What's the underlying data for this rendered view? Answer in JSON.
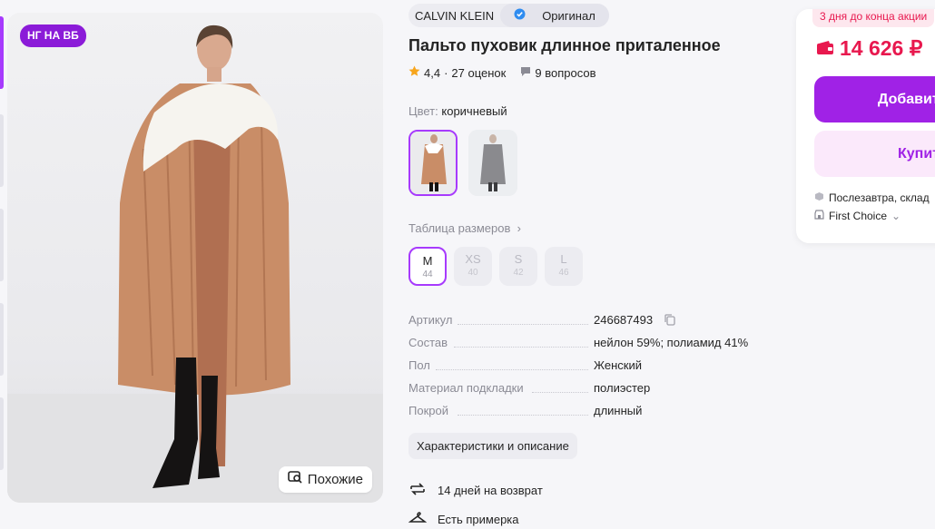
{
  "badge": "НГ НА ВБ",
  "similar_button": "Похожие",
  "brand": "CALVIN KLEIN",
  "original_label": "Оригинал",
  "title": "Пальто пуховик длинное приталенное",
  "rating": {
    "value": "4,4",
    "separator": "·",
    "reviews": "27 оценок",
    "questions": "9 вопросов"
  },
  "color": {
    "label": "Цвет:",
    "value": "коричневый"
  },
  "size_table_link": "Таблица размеров",
  "sizes": [
    {
      "name": "M",
      "ru": "44"
    },
    {
      "name": "XS",
      "ru": "40"
    },
    {
      "name": "S",
      "ru": "42"
    },
    {
      "name": "L",
      "ru": "46"
    }
  ],
  "specs": [
    {
      "key": "Артикул",
      "value": "246687493"
    },
    {
      "key": "Состав",
      "value": "нейлон 59%; полиамид 41%"
    },
    {
      "key": "Пол",
      "value": "Женский"
    },
    {
      "key": "Материал подкладки",
      "value": "полиэстер"
    },
    {
      "key": "Покрой",
      "value": "длинный"
    }
  ],
  "characteristics_button": "Характеристики и описание",
  "features": [
    "14 дней на возврат",
    "Есть примерка"
  ],
  "promo": "3 дня до конца акции",
  "price": "14 626 ₽",
  "add_to_cart": "Добавить",
  "buy_now": "Купить",
  "delivery": "Послезавтра, склад",
  "seller": "First Choice",
  "colors": {
    "accent": "#a022e6",
    "price": "#e8184e",
    "selected": "#a73afd"
  }
}
